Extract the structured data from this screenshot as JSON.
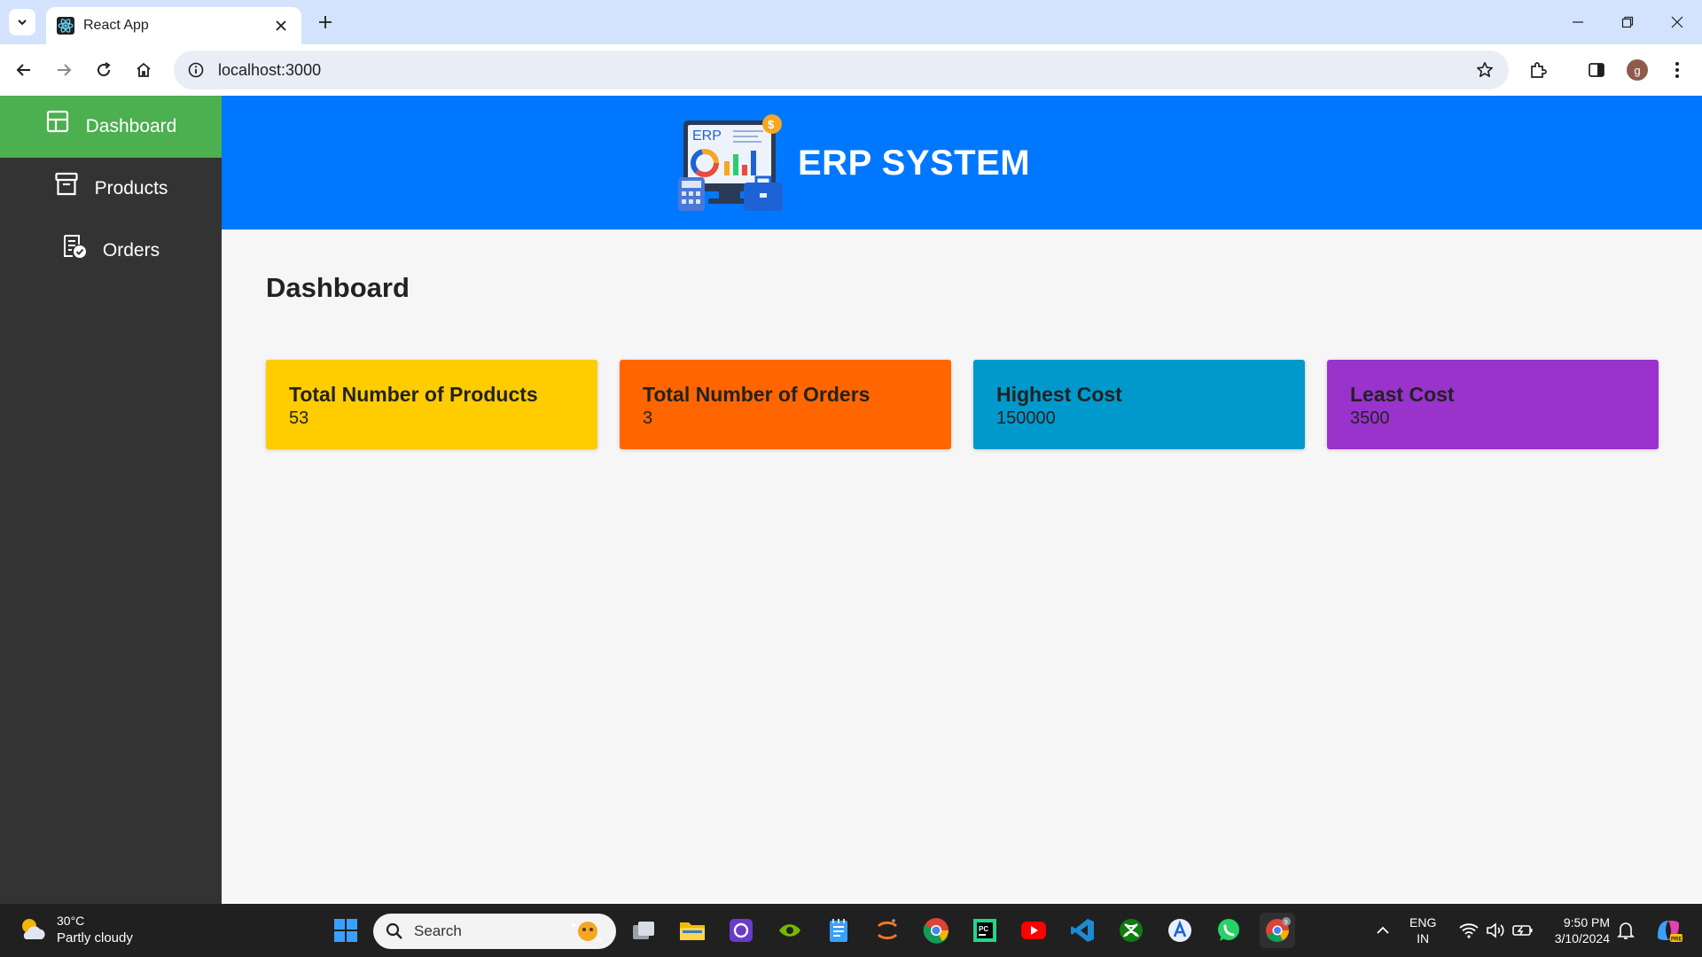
{
  "browser": {
    "tab_title": "React App",
    "url": "localhost:3000",
    "profile_initial": "g"
  },
  "sidebar": {
    "items": [
      {
        "label": "Dashboard",
        "icon": "layout-icon",
        "active": true
      },
      {
        "label": "Products",
        "icon": "archive-icon",
        "active": false
      },
      {
        "label": "Orders",
        "icon": "orders-checklist-icon",
        "active": false
      }
    ]
  },
  "header": {
    "title": "ERP SYSTEM",
    "logo_text": "ERP"
  },
  "main": {
    "page_title": "Dashboard",
    "cards": [
      {
        "label": "Total Number of Products",
        "value": "53",
        "color": "#ffcc00"
      },
      {
        "label": "Total Number of Orders",
        "value": "3",
        "color": "#ff6600"
      },
      {
        "label": "Highest Cost",
        "value": "150000",
        "color": "#0099cc"
      },
      {
        "label": "Least Cost",
        "value": "3500",
        "color": "#9933cc"
      }
    ]
  },
  "taskbar": {
    "weather_temp": "30°C",
    "weather_desc": "Partly cloudy",
    "search_placeholder": "Search",
    "language_top": "ENG",
    "language_bottom": "IN",
    "time": "9:50 PM",
    "date": "3/10/2024",
    "chrome_badge": "9"
  },
  "colors": {
    "sidebar_bg": "#333333",
    "sidebar_active": "#4caf50",
    "header_bg": "#0077ff",
    "page_bg": "#f6f6f6"
  }
}
